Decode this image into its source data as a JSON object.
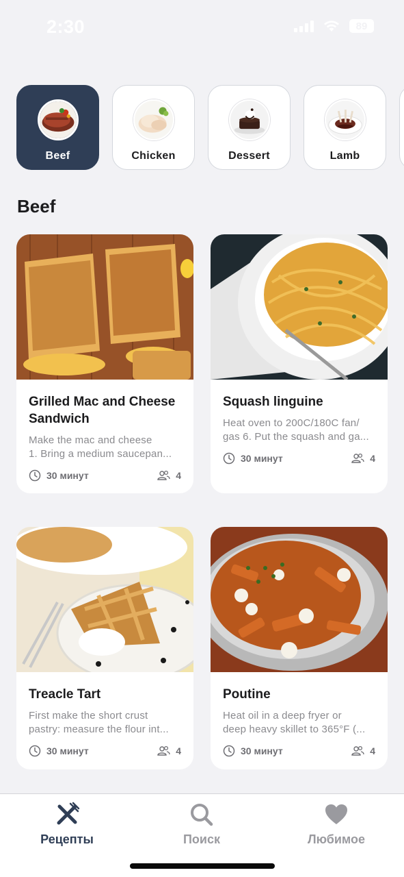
{
  "status_bar": {
    "time": "2:30",
    "battery": "89"
  },
  "categories": [
    {
      "label": "Beef",
      "active": true
    },
    {
      "label": "Chicken",
      "active": false
    },
    {
      "label": "Dessert",
      "active": false
    },
    {
      "label": "Lamb",
      "active": false
    }
  ],
  "section_title": "Beef",
  "recipes": [
    {
      "title_lines": [
        "Grilled Mac and Cheese",
        "Sandwich"
      ],
      "desc_lines": [
        "Make the mac and cheese",
        "1. Bring a medium saucepan..."
      ],
      "time": "30 минут",
      "servings": "4"
    },
    {
      "title_lines": [
        "Squash linguine"
      ],
      "desc_lines": [
        "Heat oven to 200C/180C fan/",
        "gas 6. Put the squash and ga..."
      ],
      "time": "30 минут",
      "servings": "4"
    },
    {
      "title_lines": [
        "Treacle Tart"
      ],
      "desc_lines": [
        "First make the short crust",
        "pastry: measure the flour int..."
      ],
      "time": "30 минут",
      "servings": "4"
    },
    {
      "title_lines": [
        "Poutine"
      ],
      "desc_lines": [
        "Heat oil in a deep fryer or",
        "deep heavy skillet to 365°F (..."
      ],
      "time": "30 минут",
      "servings": "4"
    }
  ],
  "tabs": [
    {
      "label": "Рецепты",
      "icon": "fork-knife-icon",
      "active": true
    },
    {
      "label": "Поиск",
      "icon": "search-icon",
      "active": false
    },
    {
      "label": "Любимое",
      "icon": "heart-icon",
      "active": false
    }
  ],
  "colors": {
    "accent": "#2f3e56",
    "background": "#f2f2f5",
    "muted_text": "#8a8a8e"
  }
}
